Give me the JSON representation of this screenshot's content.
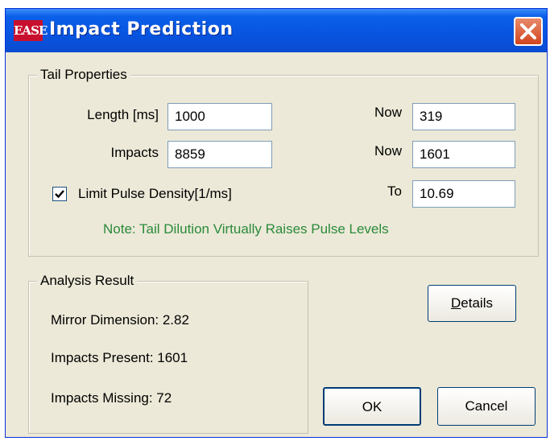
{
  "window": {
    "title": "Impact Prediction",
    "logo_text": "EASE"
  },
  "tail_properties": {
    "legend": "Tail Properties",
    "length_label": "Length [ms]",
    "length_value": "1000",
    "impacts_label": "Impacts",
    "impacts_value": "8859",
    "now1_label": "Now",
    "now1_value": "319",
    "now2_label": "Now",
    "now2_value": "1601",
    "to_label": "To",
    "to_value": "10.69",
    "limit_checkbox_label": "Limit Pulse Density[1/ms]",
    "limit_checked": true,
    "note": "Note: Tail Dilution Virtually Raises Pulse Levels"
  },
  "analysis_result": {
    "legend": "Analysis Result",
    "mirror_dimension": "Mirror Dimension: 2.82",
    "impacts_present": "Impacts Present: 1601",
    "impacts_missing": "Impacts Missing: 72"
  },
  "buttons": {
    "details_first": "D",
    "details_rest": "etails",
    "ok": "OK",
    "cancel": "Cancel"
  },
  "colors": {
    "titlebar": "#0854e0",
    "note_text": "#2a8a3a",
    "dialog_bg": "#ece9d8",
    "close_button": "#d2451e"
  }
}
